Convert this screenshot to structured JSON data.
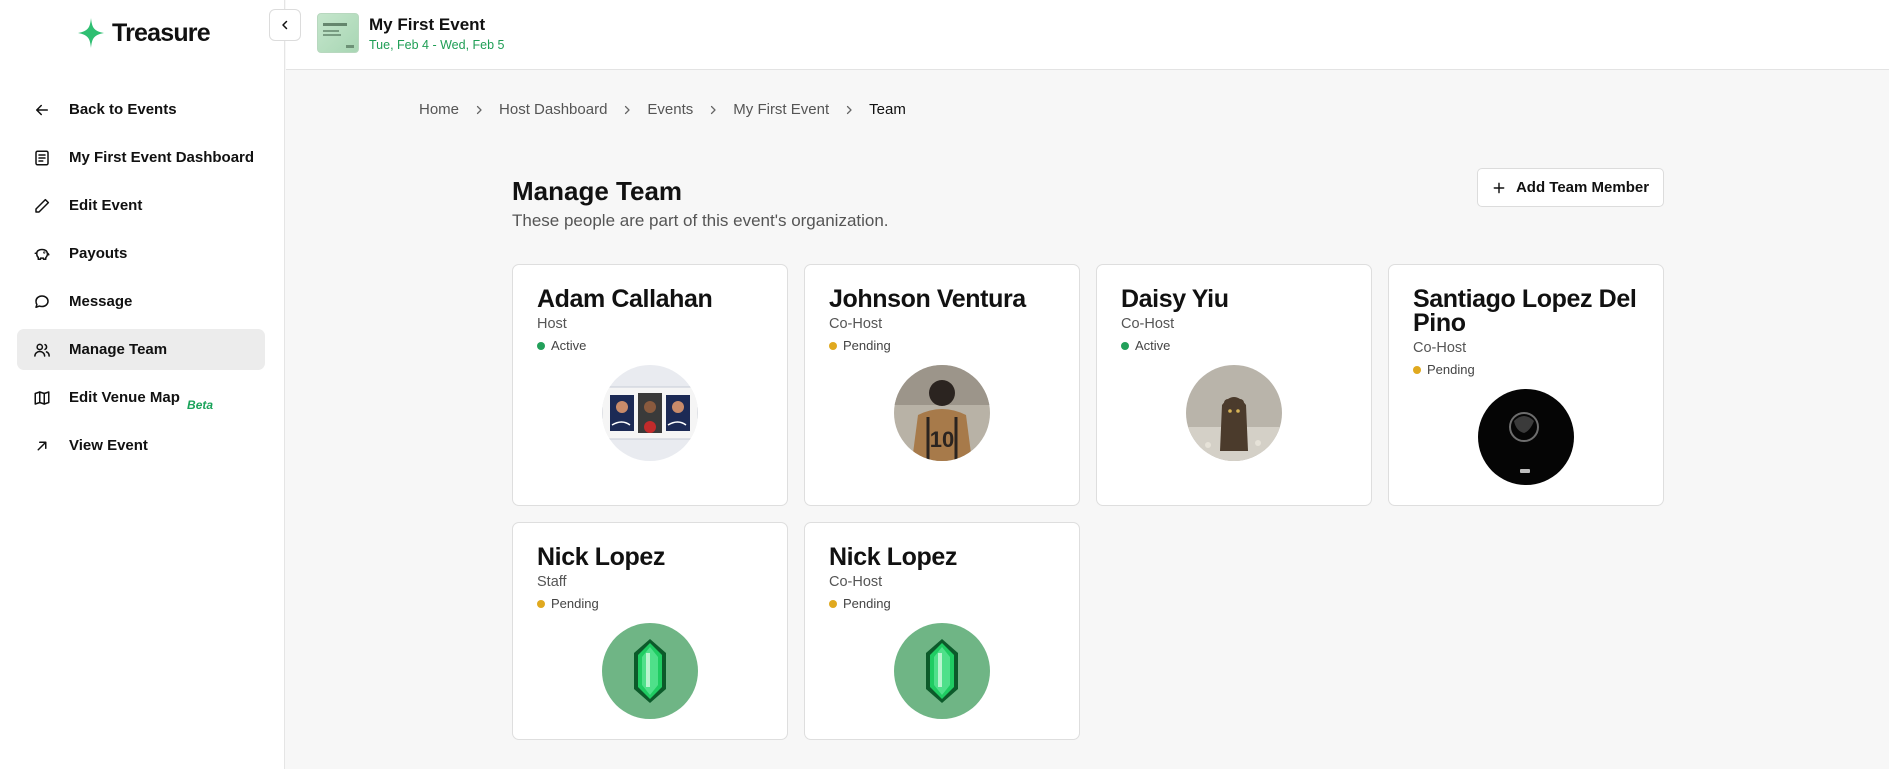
{
  "app": {
    "name": "Treasure"
  },
  "event": {
    "title": "My First Event",
    "dates": "Tue, Feb 4 - Wed, Feb 5"
  },
  "sidebar": {
    "items": [
      {
        "label": "Back to Events",
        "icon": "arrow-left-icon"
      },
      {
        "label": "My First Event Dashboard",
        "icon": "dashboard-icon"
      },
      {
        "label": "Edit Event",
        "icon": "pencil-icon"
      },
      {
        "label": "Payouts",
        "icon": "piggy-bank-icon"
      },
      {
        "label": "Message",
        "icon": "message-icon"
      },
      {
        "label": "Manage Team",
        "icon": "users-icon",
        "active": true
      },
      {
        "label": "Edit Venue Map",
        "icon": "map-icon",
        "badge": "Beta"
      },
      {
        "label": "View Event",
        "icon": "arrow-up-right-icon"
      }
    ]
  },
  "breadcrumb": [
    "Home",
    "Host Dashboard",
    "Events",
    "My First Event",
    "Team"
  ],
  "main": {
    "title": "Manage Team",
    "subtitle": "These people are part of this event's organization.",
    "add_button": "Add Team Member"
  },
  "team": [
    {
      "name": "Adam Callahan",
      "role": "Host",
      "status": "Active",
      "avatar": "photo-cards"
    },
    {
      "name": "Johnson Ventura",
      "role": "Co-Host",
      "status": "Pending",
      "avatar": "photo-jersey"
    },
    {
      "name": "Daisy Yiu",
      "role": "Co-Host",
      "status": "Active",
      "avatar": "photo-figure"
    },
    {
      "name": "Santiago Lopez Del Pino",
      "role": "Co-Host",
      "status": "Pending",
      "avatar": "photo-dark"
    },
    {
      "name": "Nick Lopez",
      "role": "Staff",
      "status": "Pending",
      "avatar": "gem"
    },
    {
      "name": "Nick Lopez",
      "role": "Co-Host",
      "status": "Pending",
      "avatar": "gem"
    }
  ],
  "colors": {
    "active": "#22a05a",
    "pending": "#e0a91f",
    "brand": "#1aa35a"
  }
}
